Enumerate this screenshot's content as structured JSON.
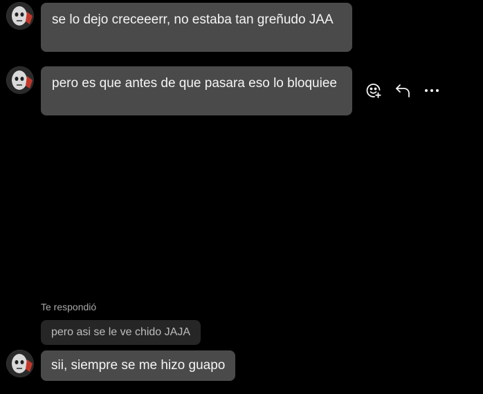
{
  "messages": [
    {
      "text": "se lo dejo creceeerr, no estaba tan greñudo JAA"
    },
    {
      "text": "pero es que antes de que pasara eso lo bloquiee"
    },
    {
      "text": "sii, siempre se me hizo guapo"
    }
  ],
  "reply": {
    "label": "Te respondió",
    "quoted_text": "pero asi se le ve chido JAJA"
  },
  "actions": {
    "icons": [
      "emoji-add-icon",
      "reply-icon",
      "more-icon"
    ]
  },
  "colors": {
    "background": "#000000",
    "bubble": "#4a4a4a",
    "quoted_bubble": "#262626",
    "text": "#f5f5f5",
    "muted": "#a8a8a8"
  }
}
